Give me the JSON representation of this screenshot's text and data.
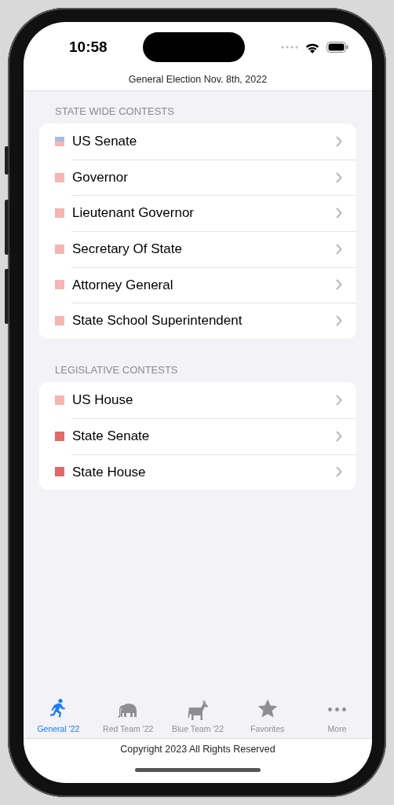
{
  "status_bar": {
    "time": "10:58"
  },
  "header": {
    "title": "General Election Nov. 8th, 2022"
  },
  "sections": [
    {
      "title": "STATE WIDE CONTESTS",
      "items": [
        {
          "label": "US Senate",
          "swatch": [
            {
              "color": "#a9bbe0"
            },
            {
              "color": "#f5b5b3"
            }
          ]
        },
        {
          "label": "Governor",
          "swatch": [
            {
              "color": "#f5b5b3"
            }
          ]
        },
        {
          "label": "Lieutenant Governor",
          "swatch": [
            {
              "color": "#f5b5b3"
            }
          ]
        },
        {
          "label": "Secretary Of State",
          "swatch": [
            {
              "color": "#f5b5b3"
            }
          ]
        },
        {
          "label": "Attorney General",
          "swatch": [
            {
              "color": "#f5b5b3"
            }
          ]
        },
        {
          "label": "State School Superintendent",
          "swatch": [
            {
              "color": "#f5b5b3"
            }
          ]
        }
      ]
    },
    {
      "title": "LEGISLATIVE CONTESTS",
      "items": [
        {
          "label": "US House",
          "swatch": [
            {
              "color": "#f5b5b3"
            }
          ]
        },
        {
          "label": "State Senate",
          "swatch": [
            {
              "color": "#e06a68"
            }
          ]
        },
        {
          "label": "State House",
          "swatch": [
            {
              "color": "#e06a68"
            }
          ]
        }
      ]
    }
  ],
  "tabs": [
    {
      "label": "General '22",
      "selected": true
    },
    {
      "label": "Red Team '22",
      "selected": false
    },
    {
      "label": "Blue Team '22",
      "selected": false
    },
    {
      "label": "Favorites",
      "selected": false
    },
    {
      "label": "More",
      "selected": false
    }
  ],
  "footer": {
    "text": "Copyright 2023 All Rights Reserved"
  }
}
